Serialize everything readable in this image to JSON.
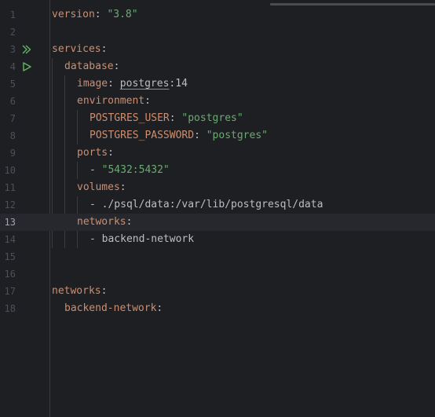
{
  "editor": {
    "colors": {
      "background": "#1e1f22",
      "current_line": "#26282e",
      "key": "#cf8e6d",
      "string": "#6aab73",
      "text": "#bcbec4",
      "line_number": "#4b5059",
      "run_icon": "#5fb865"
    },
    "current_line": 13,
    "line_numbers": [
      "1",
      "2",
      "3",
      "4",
      "5",
      "6",
      "7",
      "8",
      "9",
      "10",
      "11",
      "12",
      "13",
      "14",
      "15",
      "16",
      "17",
      "18"
    ],
    "run_icons": [
      {
        "line": 3,
        "icon": "run-all-icon"
      },
      {
        "line": 4,
        "icon": "run-icon"
      }
    ],
    "code": {
      "l1_key": "version",
      "l1_sep": ": ",
      "l1_val": "\"3.8\"",
      "l3_key": "services",
      "l3_sep": ":",
      "l4_key": "database",
      "l4_sep": ":",
      "l5_key": "image",
      "l5_sep": ": ",
      "l5_val_a": "postgres",
      "l5_val_b": ":14",
      "l6_key": "environment",
      "l6_sep": ":",
      "l7_key": "POSTGRES_USER",
      "l7_sep": ": ",
      "l7_val": "\"postgres\"",
      "l8_key": "POSTGRES_PASSWORD",
      "l8_sep": ": ",
      "l8_val": "\"postgres\"",
      "l9_key": "ports",
      "l9_sep": ":",
      "l10_dash": "- ",
      "l10_val": "\"5432:5432\"",
      "l11_key": "volumes",
      "l11_sep": ":",
      "l12_dash": "- ",
      "l12_val": "./psql/data:/var/lib/postgresql/data",
      "l13_key": "networks",
      "l13_sep": ":",
      "l14_dash": "- ",
      "l14_val": "backend-network",
      "l17_key": "networks",
      "l17_sep": ":",
      "l18_key": "backend-network",
      "l18_sep": ":"
    }
  }
}
